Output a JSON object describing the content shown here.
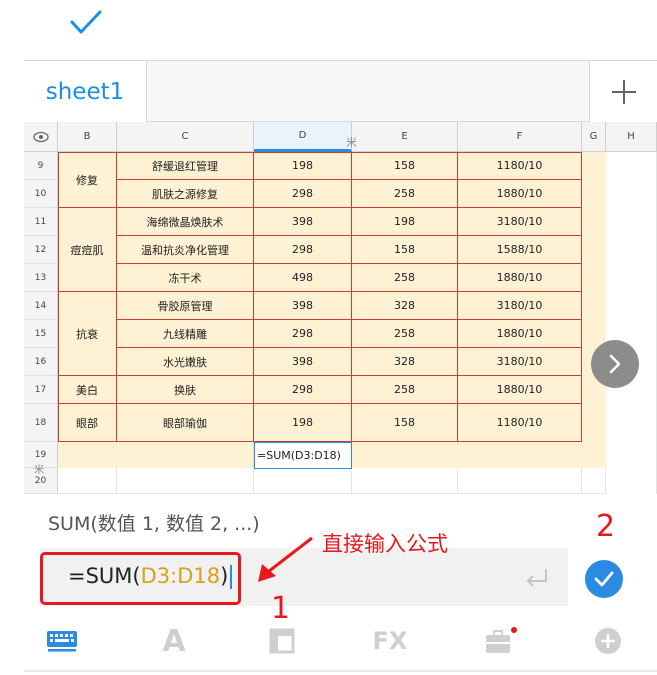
{
  "tabs": [
    {
      "label": "sheet1"
    }
  ],
  "grid": {
    "columns": [
      "B",
      "C",
      "D",
      "E",
      "F",
      "G",
      "H"
    ],
    "rows": [
      {
        "n": "9",
        "cat": "修复",
        "item": "舒缓退红管理",
        "d": "198",
        "e": "158",
        "f": "1180/10"
      },
      {
        "n": "10",
        "cat": "",
        "item": "肌肤之源修复",
        "d": "298",
        "e": "258",
        "f": "1880/10"
      },
      {
        "n": "11",
        "cat": "痘痘肌",
        "item": "海绵微晶焕肤术",
        "d": "398",
        "e": "198",
        "f": "3180/10"
      },
      {
        "n": "12",
        "cat": "",
        "item": "温和抗炎净化管理",
        "d": "298",
        "e": "158",
        "f": "1588/10"
      },
      {
        "n": "13",
        "cat": "",
        "item": "冻干术",
        "d": "498",
        "e": "258",
        "f": "1880/10"
      },
      {
        "n": "14",
        "cat": "抗衰",
        "item": "骨胶原管理",
        "d": "398",
        "e": "328",
        "f": "3180/10"
      },
      {
        "n": "15",
        "cat": "",
        "item": "九线精雕",
        "d": "298",
        "e": "258",
        "f": "1880/10"
      },
      {
        "n": "16",
        "cat": "",
        "item": "水光嫩肤",
        "d": "398",
        "e": "328",
        "f": "3180/10"
      },
      {
        "n": "17",
        "cat": "美白",
        "item": "换肤",
        "d": "298",
        "e": "258",
        "f": "1880/10"
      },
      {
        "n": "18",
        "cat": "眼部",
        "item": "眼部瑜伽",
        "d": "198",
        "e": "158",
        "f": "1180/10"
      }
    ],
    "extra_rows": [
      "19",
      "20"
    ],
    "selected_cell": {
      "formula": "=SUM(D3:D18)"
    },
    "marks": {
      "col_resize": "米",
      "row_resize": "米"
    }
  },
  "formula_bar": {
    "hint": "SUM(数值 1, 数值 2, ...)",
    "prefix": "=SUM(",
    "ref": "D3:D18",
    "suffix": ")"
  },
  "annotations": {
    "label": "直接输入公式",
    "step1": "1",
    "step2": "2",
    "color": "#e8191c"
  },
  "toolbar": [
    {
      "name": "keyboard-icon",
      "active": true
    },
    {
      "name": "format-icon",
      "label": "A"
    },
    {
      "name": "layout-icon"
    },
    {
      "name": "fx-icon",
      "label": "FX"
    },
    {
      "name": "toolbox-icon",
      "badge": true
    },
    {
      "name": "add-icon"
    }
  ],
  "colors": {
    "accent": "#2a8be0",
    "table_fill": "#fff1d4",
    "table_border": "#c9402f",
    "reference": "#d9a018"
  }
}
